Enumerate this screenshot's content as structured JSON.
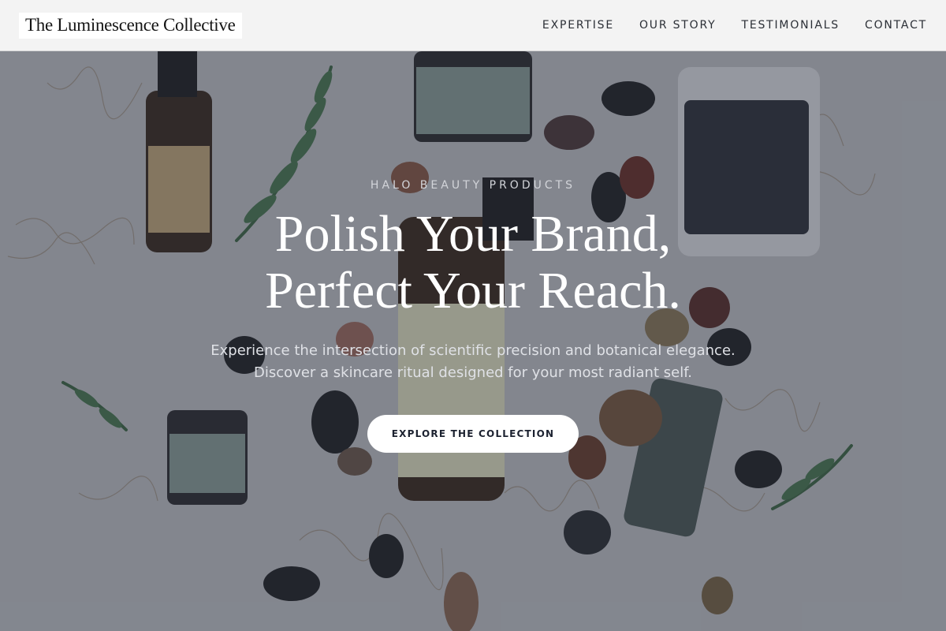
{
  "header": {
    "logo": "The Luminescence Collective",
    "nav": [
      "EXPERTISE",
      "OUR STORY",
      "TESTIMONIALS",
      "CONTACT"
    ]
  },
  "hero": {
    "eyebrow": "HALO BEAUTY PRODUCTS",
    "headline_line1": "Polish Your Brand,",
    "headline_line2": "Perfect Your Reach.",
    "subhead": "Experience the intersection of scientific precision and botanical elegance. Discover a skincare ritual designed for your most radiant self.",
    "cta_label": "EXPLORE THE COLLECTION"
  },
  "colors": {
    "header_bg": "#f3f3f3",
    "hero_overlay": "#262c3a",
    "cta_bg": "#ffffff",
    "cta_text": "#1c2230"
  }
}
